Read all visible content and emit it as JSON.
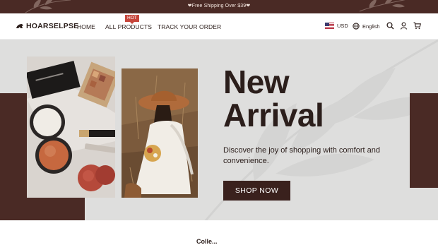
{
  "announcement": {
    "text": "❤Free Shipping Over $39❤"
  },
  "brand": {
    "name": "HOARSELPSE"
  },
  "nav": [
    {
      "label": "HOME"
    },
    {
      "label": "ALL PRODUCTS",
      "badge": "HOT"
    },
    {
      "label": "TRACK YOUR ORDER"
    }
  ],
  "utilities": {
    "currency": "USD",
    "language": "English",
    "icons": [
      "flag-us-icon",
      "globe-icon",
      "search-icon",
      "account-icon",
      "cart-icon"
    ]
  },
  "hero": {
    "title_line1": "New",
    "title_line2": "Arrival",
    "subtitle": "Discover the joy of shopping with comfort and convenience.",
    "cta_label": "SHOP NOW"
  },
  "next_section": {
    "heading_partial": "Colle..."
  },
  "colors": {
    "brand_brown": "#4a2a25",
    "dark_brown": "#3a211d",
    "hero_bg": "#dededd",
    "hot_badge": "#c6453b"
  }
}
